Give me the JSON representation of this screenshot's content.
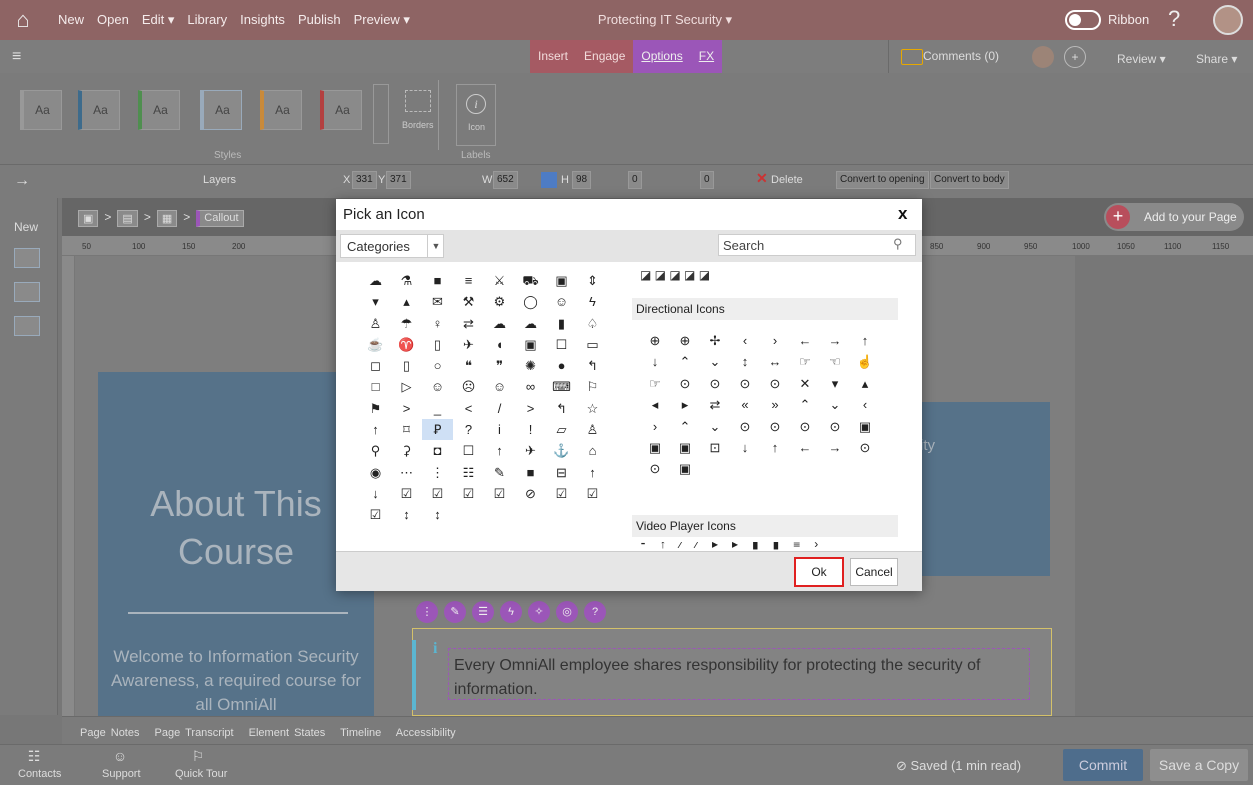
{
  "topbar": {
    "home_icon": "home-icon",
    "menu": [
      "New",
      "Open",
      "Edit ▾",
      "Library",
      "Insights",
      "Publish",
      "Preview ▾"
    ],
    "title": "Protecting IT Security ▾",
    "ribbon_label": "Ribbon",
    "help": "?"
  },
  "tabs": [
    "Insert",
    "Engage",
    "Options",
    "FX"
  ],
  "comments": "Comments (0)",
  "review": "Review ▾",
  "share": "Share ▾",
  "ribbon": {
    "style_boxes": [
      "Aa",
      "Aa",
      "Aa",
      "Aa",
      "Aa",
      "Aa"
    ],
    "borders": "Borders",
    "icon": "Icon",
    "styles": "Styles",
    "labels": "Labels"
  },
  "toolbar": {
    "layers": "Layers",
    "x": "331",
    "y": "371",
    "x_lbl": "X",
    "y_lbl": "Y",
    "w_lbl": "W",
    "h_lbl": "H",
    "w": "652",
    "h": "98",
    "val1": "0",
    "val2": "0",
    "delete": "Delete",
    "convert_opening": "Convert to opening",
    "convert_body": "Convert to body"
  },
  "sidebar": {
    "new": "New"
  },
  "crumb": {
    "callout": "Callout",
    "arrow": ">"
  },
  "add_page": "Add to your Page",
  "ruler": [
    "50",
    "100",
    "150",
    "200",
    "850",
    "900",
    "950",
    "1000",
    "1050",
    "1100",
    "1150"
  ],
  "slide": {
    "about": "About This Course",
    "welcome": "Welcome to Information Security Awareness, a required course for all OmniAll",
    "right_text": "rity\ns",
    "info": "Every OmniAll employee shares responsibility for protecting the security of information."
  },
  "page_tabs": [
    "Page Notes",
    "Page Transcript",
    "Element States",
    "Timeline",
    "Accessibility"
  ],
  "bottom": {
    "contacts": "Contacts",
    "support": "Support",
    "quick_tour": "Quick Tour",
    "saved": "⊘ Saved (1 min read)",
    "commit": "Commit",
    "save_copy": "Save a Copy"
  },
  "dialog": {
    "title": "Pick an Icon",
    "close": "x",
    "category": "Categories",
    "search_placeholder": "Search",
    "left_icons": "☁⚗■≡⚔⛟▣⇕▾▴✉⚒⚙◯☺ϟ♙☂♀⇄☁☁▮♤☕♈▯✈◖▣☐▭◻▯○❝❞✺●↰□▷☺☹☺∞⌨⚐⚑>_</>↰☆↑⌑Ꝑ?i!▱♙⚲⚳◘☐↑✈⚓⌂◉⋯⋮☷✎■⊟↑↓☑☑☑☑⊘☑☑☑↕↕",
    "right_row0": "◪ ◪ ◪ ◪ ◪",
    "directional_header": "Directional Icons",
    "right_icons": "⊕⊕✢‹›←→↑↓⌃⌄↕↔☞☜☝☞⊙⊙⊙⊙✕▾▴◂▸⇄«»⌃⌄‹›⌃⌄⊙⊙⊙⊙▣▣▣⊡↓↑←→⊙⊙▣",
    "video_header": "Video Player Icons",
    "video_row": "⁃↑⁄⁄▸▸▮▮≡›",
    "ok": "Ok",
    "cancel": "Cancel"
  },
  "colors": {
    "topbar": "#8e6464",
    "accent": "#9b56b8",
    "ok_outline": "#e02020",
    "commit": "#4e6d8c"
  }
}
